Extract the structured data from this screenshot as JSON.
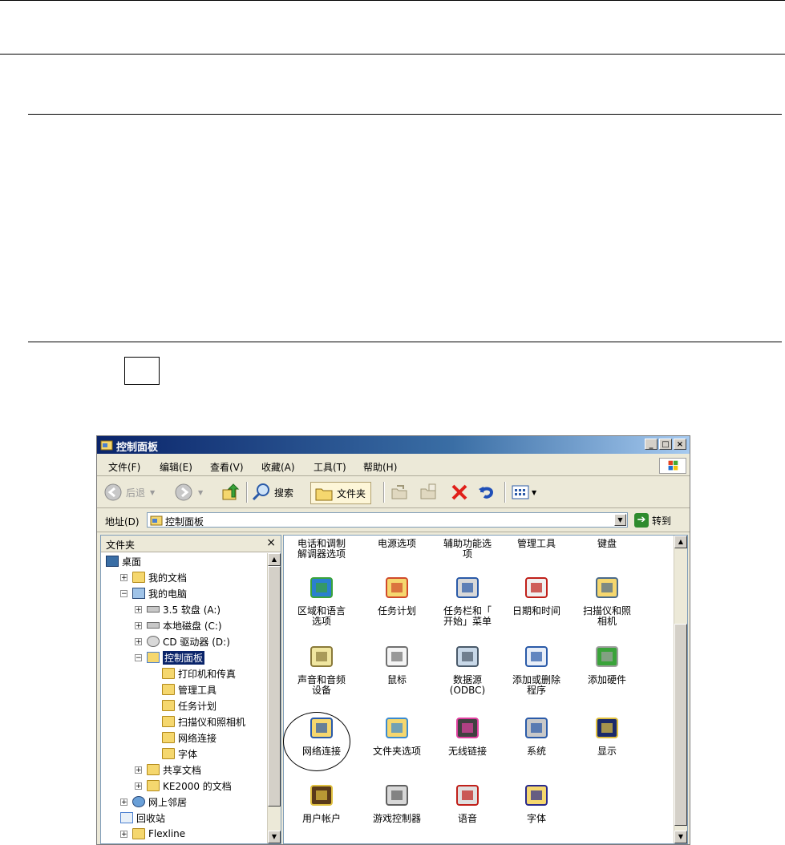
{
  "window": {
    "title": "控制面板",
    "controls": [
      "_",
      "□",
      "×"
    ]
  },
  "menubar": [
    "文件(F)",
    "编辑(E)",
    "查看(V)",
    "收藏(A)",
    "工具(T)",
    "帮助(H)"
  ],
  "toolbar": {
    "back": "后退",
    "search": "搜索",
    "folders": "文件夹"
  },
  "address": {
    "label": "地址(D)",
    "value": "控制面板",
    "go": "转到"
  },
  "folder_pane": {
    "title": "文件夹",
    "close": "×",
    "tree": [
      {
        "label": "桌面"
      },
      {
        "label": "我的文档",
        "exp": "+"
      },
      {
        "label": "我的电脑",
        "exp": "−"
      },
      {
        "label": "3.5 软盘 (A:)",
        "exp": "+"
      },
      {
        "label": "本地磁盘 (C:)",
        "exp": "+"
      },
      {
        "label": "CD 驱动器 (D:)",
        "exp": "+"
      },
      {
        "label": "控制面板",
        "exp": "−",
        "selected": true
      },
      {
        "label": "打印机和传真"
      },
      {
        "label": "管理工具"
      },
      {
        "label": "任务计划"
      },
      {
        "label": "扫描仪和照相机"
      },
      {
        "label": "网络连接"
      },
      {
        "label": "字体"
      },
      {
        "label": "共享文档",
        "exp": "+"
      },
      {
        "label": "KE2000 的文档",
        "exp": "+"
      },
      {
        "label": "网上邻居",
        "exp": "+"
      },
      {
        "label": "回收站"
      },
      {
        "label": "Flexline",
        "exp": "+"
      }
    ]
  },
  "items_top_row": [
    "电话和调制\n解调器选项",
    "电源选项",
    "辅助功能选\n项",
    "管理工具",
    "键盘"
  ],
  "items": [
    {
      "label": "区域和语言\n选项",
      "icon": "globe-icon"
    },
    {
      "label": "任务计划",
      "icon": "scheduled-tasks-icon"
    },
    {
      "label": "任务栏和「\n开始」菜单",
      "icon": "taskbar-icon"
    },
    {
      "label": "日期和时间",
      "icon": "calendar-clock-icon"
    },
    {
      "label": "扫描仪和照\n相机",
      "icon": "scanner-icon"
    },
    {
      "label": "声音和音频\n设备",
      "icon": "speaker-icon"
    },
    {
      "label": "鼠标",
      "icon": "mouse-icon"
    },
    {
      "label": "数据源\n(ODBC)",
      "icon": "database-icon"
    },
    {
      "label": "添加或删除\n程序",
      "icon": "add-remove-programs-icon"
    },
    {
      "label": "添加硬件",
      "icon": "add-hardware-icon"
    },
    {
      "label": "网络连接",
      "icon": "network-connections-icon"
    },
    {
      "label": "文件夹选项",
      "icon": "folder-options-icon"
    },
    {
      "label": "无线链接",
      "icon": "wireless-link-icon"
    },
    {
      "label": "系统",
      "icon": "system-icon"
    },
    {
      "label": "显示",
      "icon": "display-icon"
    },
    {
      "label": "用户帐户",
      "icon": "user-accounts-icon"
    },
    {
      "label": "游戏控制器",
      "icon": "game-controller-icon"
    },
    {
      "label": "语音",
      "icon": "speech-icon"
    },
    {
      "label": "字体",
      "icon": "fonts-icon"
    }
  ]
}
